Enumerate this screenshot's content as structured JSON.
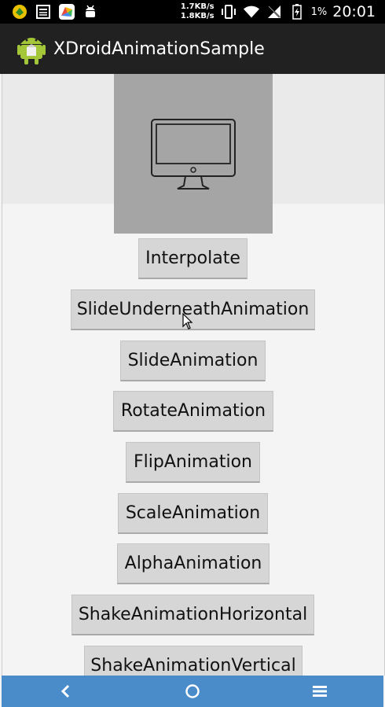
{
  "status_bar": {
    "net_up": "1.7KB/s",
    "net_down": "1.8KB/s",
    "battery_percent": "1%",
    "time": "20:01",
    "icons": [
      "app-notification-icon",
      "news-icon",
      "browser-icon",
      "android-debug-icon",
      "vibrate-icon",
      "wifi-icon",
      "no-sim-icon",
      "battery-charging-icon"
    ]
  },
  "action_bar": {
    "title": "XDroidAnimationSample",
    "logo": "android-app-icon"
  },
  "preview": {
    "icon": "desktop-monitor-icon"
  },
  "buttons": [
    "Interpolate",
    "SlideUnderneathAnimation",
    "SlideAnimation",
    "RotateAnimation",
    "FlipAnimation",
    "ScaleAnimation",
    "AlphaAnimation",
    "ShakeAnimationHorizontal",
    "ShakeAnimationVertical"
  ],
  "nav_bar": {
    "icons": [
      "back-icon",
      "home-icon",
      "menu-icon"
    ]
  },
  "colors": {
    "status_bar": "#000000",
    "action_bar": "#212121",
    "nav_bar": "#4a8cc9",
    "button": "#d6d6d6",
    "preview": "#a5a5a5"
  }
}
